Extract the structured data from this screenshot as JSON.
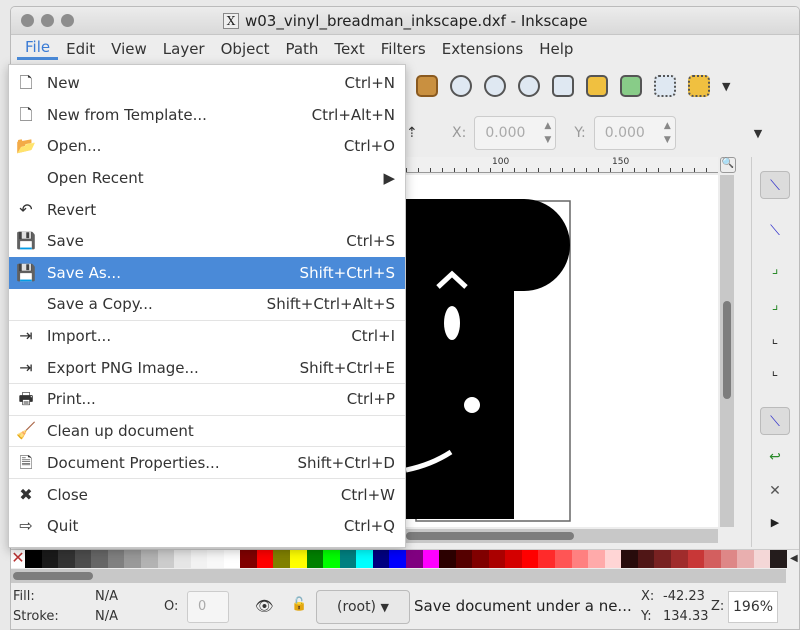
{
  "window": {
    "title": "w03_vinyl_breadman_inkscape.dxf - Inkscape"
  },
  "menubar": [
    "File",
    "Edit",
    "View",
    "Layer",
    "Object",
    "Path",
    "Text",
    "Filters",
    "Extensions",
    "Help"
  ],
  "file_menu": [
    {
      "label": "New",
      "shortcut": "Ctrl+N",
      "icon": "new-document-icon",
      "glyph": "🗋"
    },
    {
      "label": "New from Template...",
      "shortcut": "Ctrl+Alt+N",
      "icon": "template-icon",
      "glyph": "🗋"
    },
    {
      "label": "Open...",
      "shortcut": "Ctrl+O",
      "icon": "folder-icon",
      "glyph": "📂"
    },
    {
      "label": "Open Recent",
      "shortcut": "▶",
      "icon": "",
      "glyph": ""
    },
    {
      "label": "Revert",
      "shortcut": "",
      "icon": "revert-icon",
      "glyph": "↶"
    },
    {
      "label": "Save",
      "shortcut": "Ctrl+S",
      "icon": "save-icon",
      "glyph": "💾"
    },
    {
      "label": "Save As...",
      "shortcut": "Shift+Ctrl+S",
      "icon": "save-as-icon",
      "glyph": "💾",
      "highlighted": true
    },
    {
      "label": "Save a Copy...",
      "shortcut": "Shift+Ctrl+Alt+S",
      "icon": "",
      "glyph": "",
      "separator": true
    },
    {
      "label": "Import...",
      "shortcut": "Ctrl+I",
      "icon": "import-icon",
      "glyph": "⇥"
    },
    {
      "label": "Export PNG Image...",
      "shortcut": "Shift+Ctrl+E",
      "icon": "export-icon",
      "glyph": "⇥",
      "separator": true
    },
    {
      "label": "Print...",
      "shortcut": "Ctrl+P",
      "icon": "printer-icon",
      "glyph": "🖶",
      "separator": true
    },
    {
      "label": "Clean up document",
      "shortcut": "",
      "icon": "vacuum-icon",
      "glyph": "🧹",
      "separator": true
    },
    {
      "label": "Document Properties...",
      "shortcut": "Shift+Ctrl+D",
      "icon": "document-properties-icon",
      "glyph": "🗎",
      "separator": true
    },
    {
      "label": "Close",
      "shortcut": "Ctrl+W",
      "icon": "close-icon",
      "glyph": "✖"
    },
    {
      "label": "Quit",
      "shortcut": "Ctrl+Q",
      "icon": "quit-icon",
      "glyph": "⇨"
    }
  ],
  "toolbar": {
    "x_label": "X:",
    "x_value": "0.000",
    "y_label": "Y:",
    "y_value": "0.000"
  },
  "ruler": {
    "ticks": [
      "100",
      "150"
    ]
  },
  "palette": [
    "#000000",
    "#1a1a1a",
    "#333333",
    "#4d4d4d",
    "#666666",
    "#808080",
    "#999999",
    "#b3b3b3",
    "#cccccc",
    "#e6e6e6",
    "#f2f2f2",
    "#f8f8f8",
    "#ffffff",
    "#800000",
    "#ff0000",
    "#808000",
    "#ffff00",
    "#008000",
    "#00ff00",
    "#008080",
    "#00ffff",
    "#000080",
    "#0000ff",
    "#800080",
    "#ff00ff",
    "#2b0000",
    "#550000",
    "#800000",
    "#aa0000",
    "#d40000",
    "#ff0000",
    "#ff2a2a",
    "#ff5555",
    "#ff8080",
    "#ffaaaa",
    "#ffd5d5",
    "#280b0b",
    "#501616",
    "#782121",
    "#a02c2c",
    "#c83737",
    "#d35f5f",
    "#de8787",
    "#e9afaf",
    "#f4d7d7",
    "#241c1c"
  ],
  "status": {
    "fill_label": "Fill:",
    "fill_value": "N/A",
    "stroke_label": "Stroke:",
    "stroke_value": "N/A",
    "opacity_label": "O:",
    "opacity_value": "0",
    "layer": "(root)",
    "message": "Save document under a ne...",
    "x_label": "X:",
    "x_value": "-42.23",
    "y_label": "Y:",
    "y_value": "134.33",
    "zoom_label": "Z:",
    "zoom_value": "196%"
  }
}
